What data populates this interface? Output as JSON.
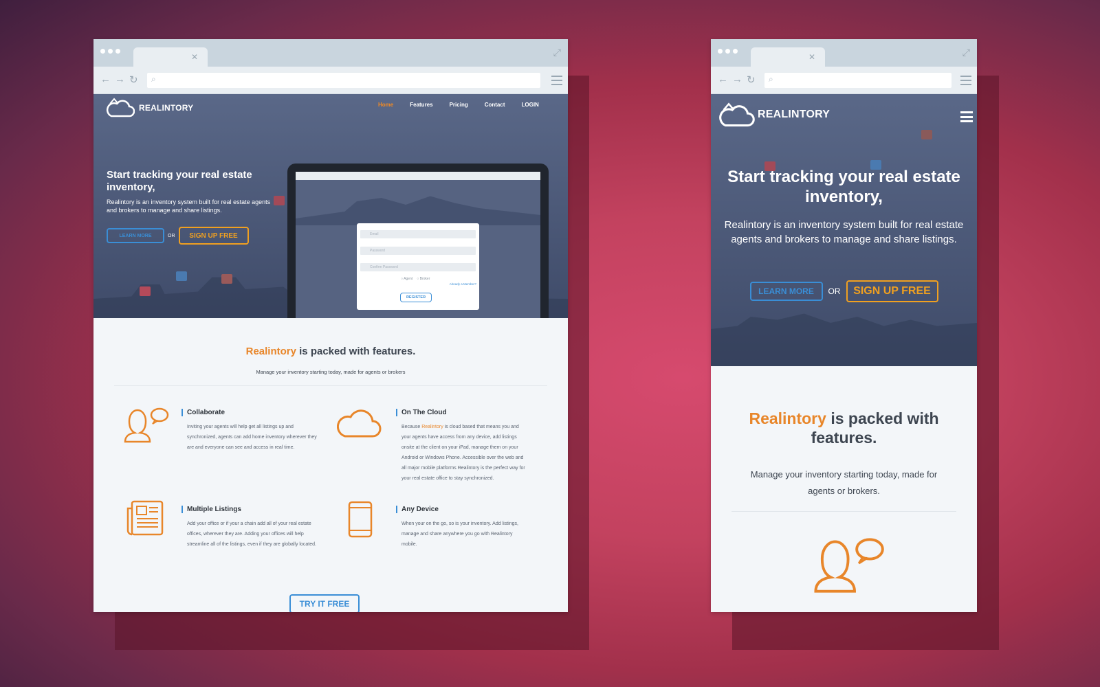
{
  "brand": "REALINTORY",
  "nav": {
    "home": "Home",
    "features": "Features",
    "pricing": "Pricing",
    "contact": "Contact",
    "login": "LOGIN"
  },
  "hero": {
    "title": "Start tracking your real estate inventory,",
    "subtitle": "Realintory is an inventory system built for real estate agents and brokers to manage and share listings.",
    "learn_more": "LEARN MORE",
    "or": "OR",
    "signup": "SIGN UP FREE"
  },
  "signup_form": {
    "email": "Email",
    "password": "Password",
    "confirm": "Confirm Password",
    "agent": "Agent",
    "broker": "Broker",
    "member": "Already a Member?",
    "register": "REGISTER"
  },
  "features_section": {
    "title_brand": "Realintory",
    "title_rest": " is packed with features.",
    "subtitle_desktop": "Manage your inventory starting today, made for agents or brokers",
    "subtitle_mobile": "Manage your inventory starting today, made for agents or brokers.",
    "items": [
      {
        "title": "Collaborate",
        "text": "Inviting your agents will help get all listings up and synchronized, agents can add home inventory wherever they are and everyone can see and access in real time.",
        "icon": "person-chat-icon"
      },
      {
        "title": "On The Cloud",
        "text_pre": "Because ",
        "text_brand": "Realintory",
        "text_post": " is cloud based that means you and your agents have access from any device, add listings onsite at the client on your iPad, manage them on your Android or Windows Phone. Accessible over the web and all major mobile platforms Realintory is the perfect way for your real estate office to stay synchronized.",
        "icon": "cloud-icon"
      },
      {
        "title": "Multiple Listings",
        "text": "Add your office or if your a chain add all of your real estate offices, wherever they are. Adding your offices will help streamline all of the listings, even if they are globally located.",
        "icon": "newspaper-icon"
      },
      {
        "title": "Any Device",
        "text": "When your on the go, so is your inventory. Add listings, manage and share anywhere you go with Realintory mobile.",
        "icon": "tablet-icon"
      }
    ],
    "cta": "TRY IT FREE"
  },
  "colors": {
    "accent": "#e8862a",
    "blue": "#3a8ed6",
    "hero": "#4d5a7a"
  }
}
